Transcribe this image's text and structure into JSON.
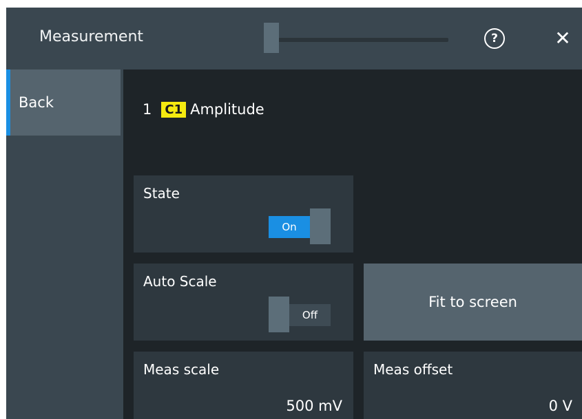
{
  "header": {
    "title": "Measurement",
    "help_glyph": "?",
    "close_glyph": "✕"
  },
  "nav": {
    "back_label": "Back"
  },
  "main": {
    "meas_number": "1",
    "channel": "C1",
    "measurement_type": "Amplitude",
    "state": {
      "label": "State",
      "value_label": "On"
    },
    "auto_scale": {
      "label": "Auto Scale",
      "value_label": "Off"
    },
    "fit_to_screen_label": "Fit to screen",
    "meas_scale": {
      "label": "Meas scale",
      "value": "500 mV"
    },
    "meas_offset": {
      "label": "Meas offset",
      "value": "0 V"
    }
  },
  "colors": {
    "accent": "#1a8fe3",
    "channel_badge": "#f5ea10",
    "titlebar": "#3a4750",
    "background": "#1e2428"
  },
  "icons": {
    "help": "help-circle-icon",
    "close": "close-icon"
  }
}
